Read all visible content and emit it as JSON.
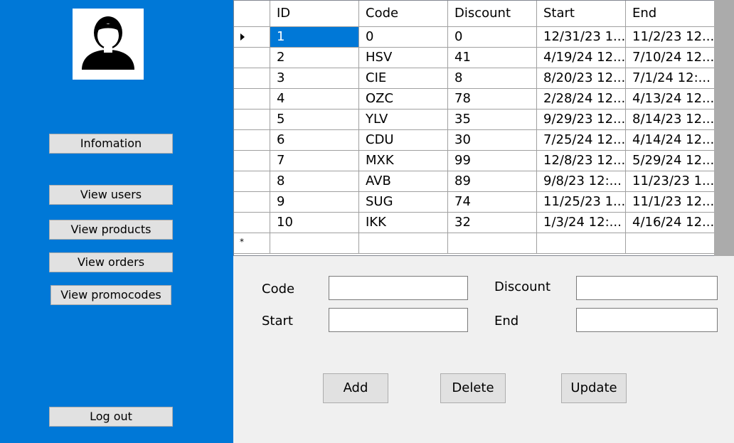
{
  "sidebar": {
    "avatar_icon": "user-icon",
    "buttons": {
      "information": "Infomation",
      "view_users": "View users",
      "view_products": "View products",
      "view_orders": "View orders",
      "view_promocodes": "View promocodes",
      "logout": "Log out"
    }
  },
  "grid": {
    "columns": [
      "ID",
      "Code",
      "Discount",
      "Start",
      "End"
    ],
    "rows": [
      [
        "1",
        "0",
        "0",
        "12/31/23 1...",
        "11/2/23 12..."
      ],
      [
        "2",
        "HSV",
        "41",
        "4/19/24 12...",
        "7/10/24 12..."
      ],
      [
        "3",
        "CIE",
        "8",
        "8/20/23 12...",
        "7/1/24 12:..."
      ],
      [
        "4",
        "OZC",
        "78",
        "2/28/24 12...",
        "4/13/24 12..."
      ],
      [
        "5",
        "YLV",
        "35",
        "9/29/23 12...",
        "8/14/23 12..."
      ],
      [
        "6",
        "CDU",
        "30",
        "7/25/24 12...",
        "4/14/24 12..."
      ],
      [
        "7",
        "MXK",
        "99",
        "12/8/23 12...",
        "5/29/24 12..."
      ],
      [
        "8",
        "AVB",
        "89",
        "9/8/23 12:...",
        "11/23/23 1..."
      ],
      [
        "9",
        "SUG",
        "74",
        "11/25/23 1...",
        "11/1/23 12..."
      ],
      [
        "10",
        "IKK",
        "32",
        "1/3/24 12:...",
        "4/16/24 12..."
      ]
    ],
    "current_row_icon": "current-row-arrow-icon",
    "new_row_icon": "new-row-asterisk-icon"
  },
  "form": {
    "code_label": "Code",
    "discount_label": "Discount",
    "start_label": "Start",
    "end_label": "End",
    "code_value": "",
    "discount_value": "",
    "start_value": "",
    "end_value": ""
  },
  "actions": {
    "add": "Add",
    "delete": "Delete",
    "update": "Update"
  },
  "colors": {
    "sidebar_bg": "#0078d7",
    "selection": "#0078d7",
    "button_bg": "#e1e1e1"
  }
}
